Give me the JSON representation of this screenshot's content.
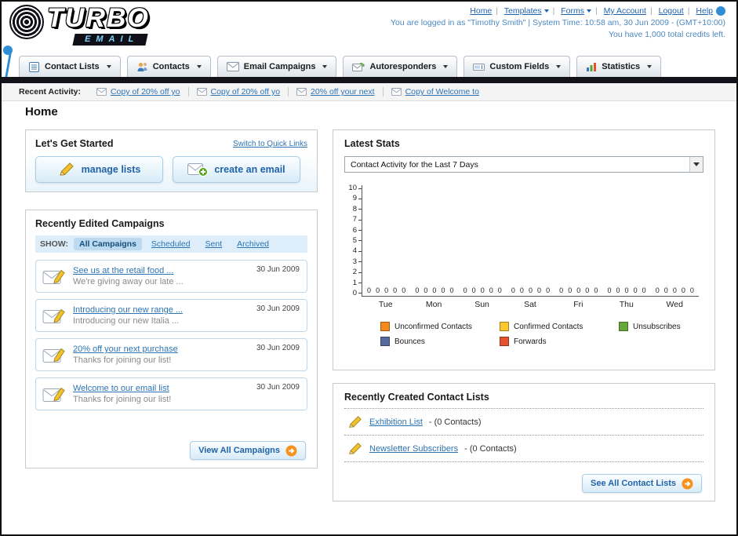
{
  "header": {
    "logo_primary": "TURBO",
    "logo_secondary": "EMAIL",
    "top_links": [
      "Home",
      "Templates",
      "Forms",
      "My Account",
      "Logout",
      "Help"
    ],
    "login_info": "You are logged in as \"Timothy Smith\" | System Time: 10:58 am, 30 Jun 2009 - (GMT+10:00)",
    "credits_info": "You have 1,000 total credits left."
  },
  "nav": {
    "tabs": [
      {
        "label": "Contact Lists"
      },
      {
        "label": "Contacts"
      },
      {
        "label": "Email Campaigns"
      },
      {
        "label": "Autoresponders"
      },
      {
        "label": "Custom Fields"
      },
      {
        "label": "Statistics"
      }
    ]
  },
  "activity": {
    "label": "Recent Activity:",
    "items": [
      "Copy of 20% off yo",
      "Copy of 20% off yo",
      "20% off your next",
      "Copy of Welcome to"
    ]
  },
  "page_title": "Home",
  "get_started": {
    "title": "Let's Get Started",
    "switch_link": "Switch to Quick Links",
    "manage_lists_label": "manage lists",
    "create_email_label": "create an email"
  },
  "campaigns": {
    "title": "Recently Edited Campaigns",
    "show_label": "SHOW:",
    "tabs": [
      "All Campaigns",
      "Scheduled",
      "Sent",
      "Archived"
    ],
    "active_tab": "All Campaigns",
    "items": [
      {
        "title": "See us at the retail food ...",
        "subtitle": "We're giving away our late ...",
        "date": "30 Jun 2009"
      },
      {
        "title": "Introducing our new range ...",
        "subtitle": "Introducing our new Italia ...",
        "date": "30 Jun 2009"
      },
      {
        "title": "20% off your next purchase",
        "subtitle": "Thanks for joining our list!",
        "date": "30 Jun 2009"
      },
      {
        "title": "Welcome to our email list",
        "subtitle": "Thanks for joining our list!",
        "date": "30 Jun 2009"
      }
    ],
    "view_all_label": "View All Campaigns"
  },
  "stats": {
    "title": "Latest Stats",
    "period_selected": "Contact Activity for the Last 7 Days"
  },
  "chart_data": {
    "type": "bar",
    "title": "Contact Activity for the Last 7 Days",
    "categories": [
      "Tue",
      "Mon",
      "Sun",
      "Sat",
      "Fri",
      "Thu",
      "Wed"
    ],
    "series": [
      {
        "name": "Unconfirmed Contacts",
        "color": "#f6891f",
        "values": [
          0,
          0,
          0,
          0,
          0,
          0,
          0
        ]
      },
      {
        "name": "Confirmed Contacts",
        "color": "#fdc530",
        "values": [
          0,
          0,
          0,
          0,
          0,
          0,
          0
        ]
      },
      {
        "name": "Unsubscribes",
        "color": "#64a83a",
        "values": [
          0,
          0,
          0,
          0,
          0,
          0,
          0
        ]
      },
      {
        "name": "Bounces",
        "color": "#55699c",
        "values": [
          0,
          0,
          0,
          0,
          0,
          0,
          0
        ]
      },
      {
        "name": "Forwards",
        "color": "#e4532e",
        "values": [
          0,
          0,
          0,
          0,
          0,
          0,
          0
        ]
      }
    ],
    "xlabel": "",
    "ylabel": "",
    "ylim": [
      0,
      10
    ],
    "ytick_step": 1,
    "grid": false,
    "legend_position": "bottom"
  },
  "contact_lists": {
    "title": "Recently Created Contact Lists",
    "items": [
      {
        "name": "Exhibition List",
        "meta": "- (0 Contacts)"
      },
      {
        "name": "Newsletter Subscribers",
        "meta": "- (0 Contacts)"
      }
    ],
    "see_all_label": "See All Contact Lists"
  }
}
